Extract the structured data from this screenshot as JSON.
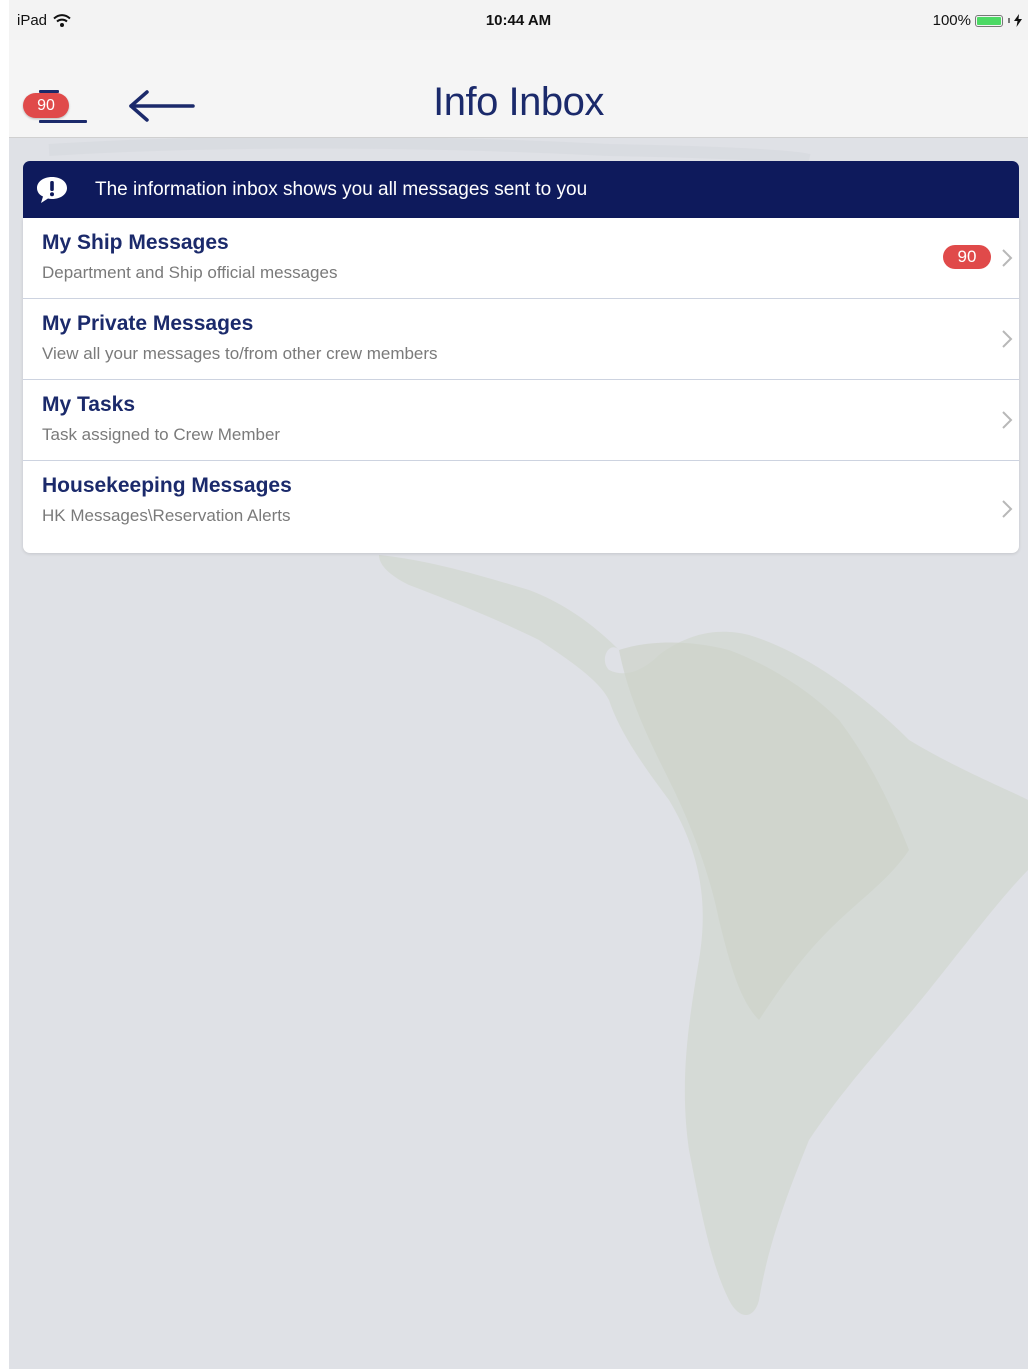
{
  "status_bar": {
    "device": "iPad",
    "time": "10:44 AM",
    "battery": "100%"
  },
  "nav": {
    "title": "Info Inbox",
    "menu_badge": "90"
  },
  "banner": {
    "text": "The information inbox shows you all messages sent to you"
  },
  "list": [
    {
      "title": "My Ship Messages",
      "subtitle": "Department and Ship official messages",
      "badge": "90"
    },
    {
      "title": "My Private Messages",
      "subtitle": "View all your messages to/from other crew members"
    },
    {
      "title": "My Tasks",
      "subtitle": "Task assigned to Crew Member"
    },
    {
      "title": "Housekeeping Messages",
      "subtitle": "HK Messages\\Reservation Alerts"
    }
  ],
  "colors": {
    "primary": "#1b2a6b",
    "banner": "#0e1a5c",
    "badge": "#e04a4a",
    "battery": "#4cd964"
  }
}
